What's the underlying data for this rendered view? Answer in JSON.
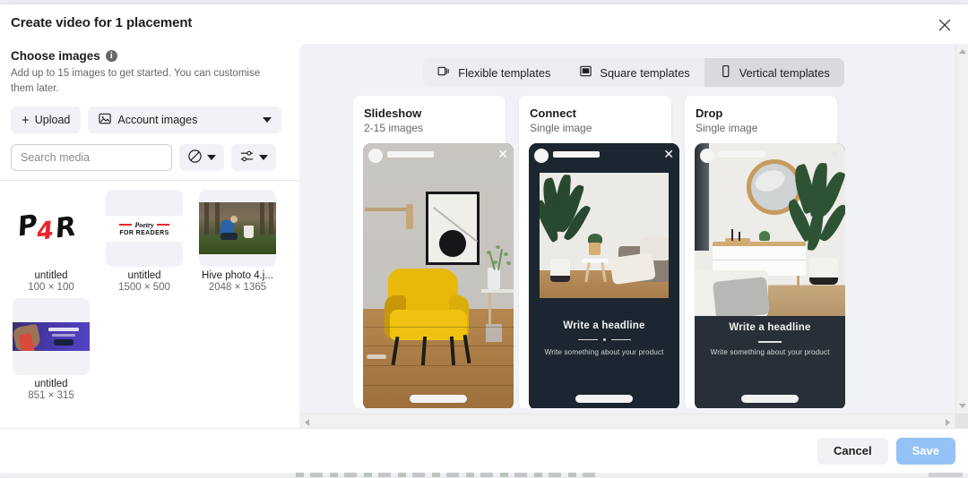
{
  "dialog": {
    "title": "Create video for 1 placement",
    "close_icon": "close-icon"
  },
  "left_panel": {
    "section_title": "Choose images",
    "info_icon": "i",
    "description": "Add up to 15 images to get started. You can customise them later.",
    "upload_button": "Upload",
    "upload_plus": "+",
    "account_images_button": "Account images",
    "search_placeholder": "Search media",
    "search_value": "",
    "media_items": [
      {
        "name": "untitled",
        "dimensions": "100 × 100",
        "art": "p4r-logo"
      },
      {
        "name": "untitled",
        "dimensions": "1500 × 500",
        "art": "poetry-banner"
      },
      {
        "name": "Hive photo 4.j...",
        "dimensions": "2048 × 1365",
        "art": "hive-photo"
      },
      {
        "name": "untitled",
        "dimensions": "851 × 315",
        "art": "promo-banner"
      }
    ],
    "poetry_logo": {
      "word": "Poetry",
      "tagline": "FOR READERS"
    },
    "p4r_logo": {
      "c1": "P",
      "c2": "4",
      "c3": "R"
    }
  },
  "right_panel": {
    "tabs": [
      {
        "label": "Flexible templates",
        "icon": "flexible-templates-icon",
        "active": false
      },
      {
        "label": "Square templates",
        "icon": "square-templates-icon",
        "active": false
      },
      {
        "label": "Vertical templates",
        "icon": "vertical-templates-icon",
        "active": true
      }
    ],
    "cards": [
      {
        "title": "Slideshow",
        "subtitle": "2-15 images",
        "headline": "",
        "body": ""
      },
      {
        "title": "Connect",
        "subtitle": "Single image",
        "headline": "Write a headline",
        "body": "Write something about your product"
      },
      {
        "title": "Drop",
        "subtitle": "Single image",
        "headline": "Write a headline",
        "body": "Write something about your product"
      }
    ]
  },
  "footer": {
    "cancel_label": "Cancel",
    "save_label": "Save"
  },
  "colors": {
    "accent": "#1877f2",
    "save_disabled": "#94c2f7",
    "panel_bg": "#f0f2f5",
    "template_dark": "#1c2630"
  }
}
